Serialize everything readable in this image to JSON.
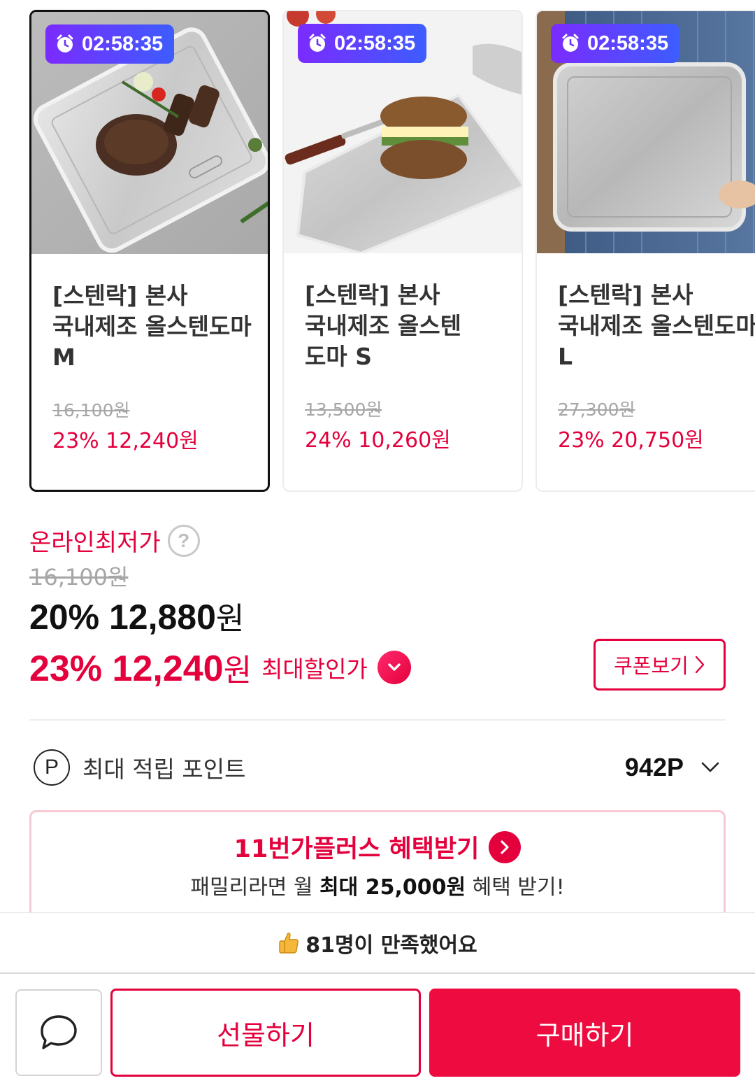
{
  "products": [
    {
      "timer": "02:58:35",
      "title": "[스텐락] 본사 국내제조 올스텐도마 M",
      "original_price": "16,100원",
      "sale_price": "23% 12,240원",
      "selected": true,
      "image": "m-board-steak"
    },
    {
      "timer": "02:58:35",
      "title": "[스텐락] 본사 국내제조 올스텐 도마 S",
      "original_price": "13,500원",
      "sale_price": "24% 10,260원",
      "selected": false,
      "image": "s-board-sandwich"
    },
    {
      "timer": "02:58:35",
      "title": "[스텐락] 본사 국내제조 올스텐도마 L",
      "original_price": "27,300원",
      "sale_price": "23% 20,750원",
      "selected": false,
      "image": "l-board-held"
    }
  ],
  "price": {
    "lowest_label": "온라인최저가",
    "help_icon": "question-icon",
    "original": "16,100원",
    "discount_rate": "20%",
    "discount_value": "12,880",
    "max_rate": "23%",
    "max_value": "12,240",
    "won": "원",
    "max_label": "최대할인가",
    "coupon_label": "쿠폰보기"
  },
  "points": {
    "icon_letter": "P",
    "label": "최대 적립 포인트",
    "value": "942P"
  },
  "plus": {
    "title": "11번가플러스 혜택받기",
    "sub_pre": "패밀리라면 월",
    "sub_bold": "최대 25,000원",
    "sub_post": "혜택 받기!"
  },
  "satisfied": {
    "icon": "thumbs-up-icon",
    "text": "81명이 만족했어요"
  },
  "actions": {
    "gift": "선물하기",
    "buy": "구매하기"
  },
  "colors": {
    "accent": "#e4003c",
    "buy_button": "#ee0b3f",
    "timer_gradient_start": "#7b2bff",
    "timer_gradient_end": "#3d5dff"
  }
}
